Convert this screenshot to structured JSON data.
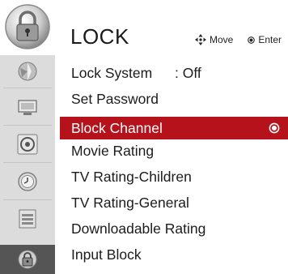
{
  "header": {
    "title": "LOCK",
    "hint_move": "Move",
    "hint_enter": "Enter",
    "icon": "lock-emblem-icon"
  },
  "sidebar": {
    "items": [
      {
        "name": "picture-icon"
      },
      {
        "name": "monitor-icon"
      },
      {
        "name": "audio-icon"
      },
      {
        "name": "clock-icon"
      },
      {
        "name": "option-icon"
      },
      {
        "name": "lock-icon",
        "active": true
      }
    ]
  },
  "menu": {
    "items": [
      {
        "label": "Lock System",
        "value": ": Off"
      },
      {
        "label": "Set Password"
      },
      {
        "label": "Block Channel",
        "selected": true
      },
      {
        "label": "Movie Rating"
      },
      {
        "label": "TV Rating-Children"
      },
      {
        "label": "TV Rating-General"
      },
      {
        "label": "Downloadable Rating"
      },
      {
        "label": "Input Block"
      }
    ]
  },
  "colors": {
    "selected_row": "#b5121b",
    "sidebar_bg": "#dcdcdc",
    "sidebar_active": "#555555"
  }
}
